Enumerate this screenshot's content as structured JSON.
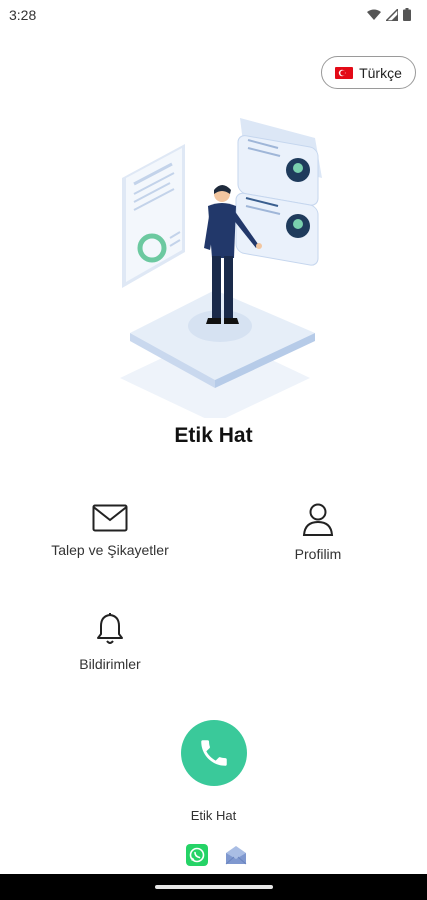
{
  "status_bar": {
    "time": "3:28"
  },
  "language": {
    "label": "Türkçe",
    "flag_color": "#e30a17"
  },
  "app": {
    "title": "Etik Hat",
    "accent": "#3ac99a"
  },
  "menu": {
    "requests": {
      "label": "Talep ve Şikayetler",
      "icon": "mail-icon"
    },
    "profile": {
      "label": "Profilim",
      "icon": "person-icon"
    },
    "notifications": {
      "label": "Bildirimler",
      "icon": "bell-icon"
    }
  },
  "call": {
    "label": "Etik Hat",
    "icon": "phone-icon"
  },
  "contacts": {
    "whatsapp_color": "#25d366",
    "email_color": "#8aa3d6"
  }
}
